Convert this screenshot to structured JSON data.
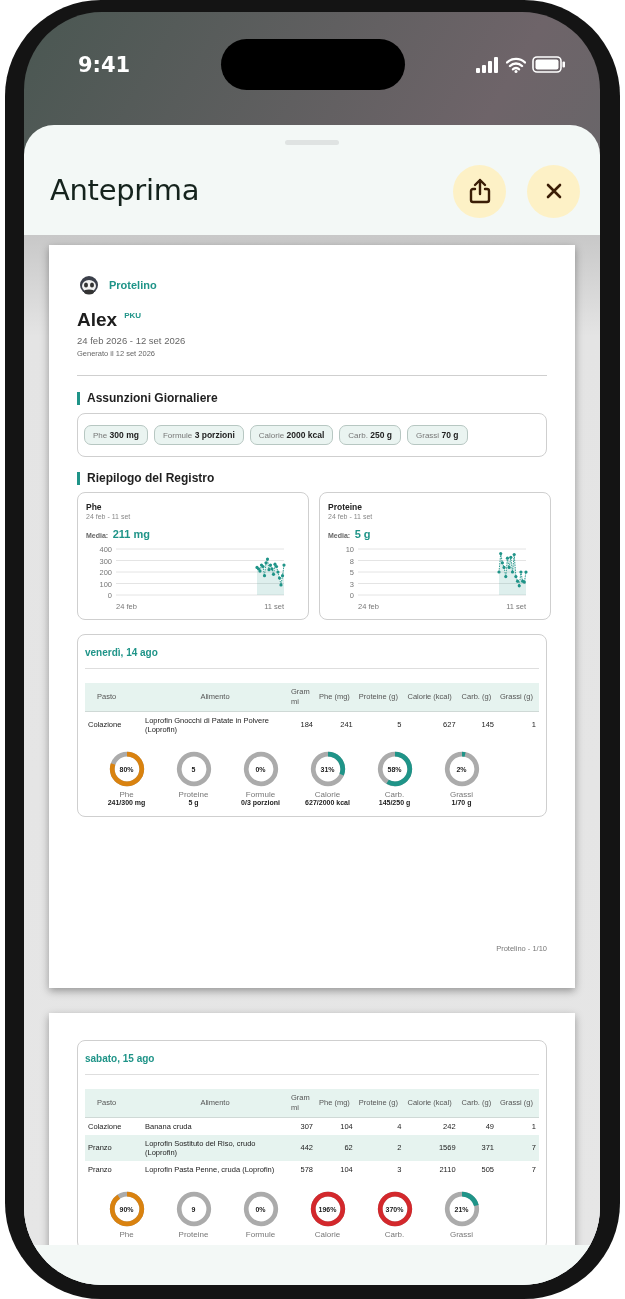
{
  "status_bar": {
    "time": "9:41"
  },
  "sheet": {
    "title": "Anteprima"
  },
  "pages": [
    {
      "header": {
        "brand": "Protelino",
        "name": "Alex",
        "tag": "PKU",
        "range": "24 feb 2026 - 12 set 2026",
        "generated": "Generato il 12 set 2026",
        "intake_heading": "Assunzioni Giornaliere",
        "chips": [
          {
            "label": "Phe",
            "value": "300 mg"
          },
          {
            "label": "Formule",
            "value": "3 porzioni"
          },
          {
            "label": "Calorie",
            "value": "2000 kcal"
          },
          {
            "label": "Carb.",
            "value": "250 g"
          },
          {
            "label": "Grassi",
            "value": "70 g"
          }
        ],
        "summary_heading": "Riepilogo del Registro",
        "summary_cards": [
          {
            "title": "Phe",
            "range": "24 feb - 11 set",
            "avg_label": "Media:",
            "avg_value": "211 mg",
            "y_ticks": [
              "400",
              "300",
              "200",
              "100",
              "0"
            ],
            "x_ticks": [
              "24 feb",
              "11 set"
            ]
          },
          {
            "title": "Proteine",
            "range": "24 feb - 11 set",
            "avg_label": "Media:",
            "avg_value": "5 g",
            "y_ticks": [
              "10",
              "8",
              "5",
              "3",
              "0"
            ],
            "x_ticks": [
              "24 feb",
              "11 set"
            ]
          }
        ]
      },
      "days": [
        {
          "date": "venerdì, 14 ago",
          "columns": [
            "Pasto",
            "Alimento",
            "Grammi",
            "Phe (mg)",
            "Proteine (g)",
            "Calorie (kcal)",
            "Carb. (g)",
            "Grassi (g)"
          ],
          "rows": [
            [
              "Colazione",
              "Loprofin Gnocchi di Patate in Polvere (Loprofin)",
              "184",
              "241",
              "5",
              "627",
              "145",
              "1"
            ]
          ],
          "gauges": [
            {
              "center": "80%",
              "label": "Phe",
              "value": "241/300 mg",
              "level": 0.8,
              "color": "#d9820f"
            },
            {
              "center": "5",
              "label": "Proteine",
              "value": "5 g"
            },
            {
              "center": "0%",
              "label": "Formule",
              "value": "0/3 porzioni"
            },
            {
              "center": "31%",
              "label": "Calorie",
              "value": "627/2000 kcal",
              "level": 0.31,
              "color": "#1f9488"
            },
            {
              "center": "58%",
              "label": "Carb.",
              "value": "145/250 g",
              "level": 0.58,
              "color": "#1f9488"
            },
            {
              "center": "2%",
              "label": "Grassi",
              "value": "1/70 g",
              "level": 0.02,
              "color": "#1f9488"
            }
          ]
        }
      ],
      "footer": "Protelino - 1/10"
    },
    {
      "days": [
        {
          "date": "sabato, 15 ago",
          "columns": [
            "Pasto",
            "Alimento",
            "Grammi",
            "Phe (mg)",
            "Proteine (g)",
            "Calorie (kcal)",
            "Carb. (g)",
            "Grassi (g)"
          ],
          "rows": [
            [
              "Colazione",
              "Banana cruda",
              "307",
              "104",
              "4",
              "242",
              "49",
              "1"
            ],
            [
              "Pranzo",
              "Loprofin Sostituto del Riso, crudo (Loprofin)",
              "442",
              "62",
              "2",
              "1569",
              "371",
              "7"
            ],
            [
              "Pranzo",
              "Loprofin Pasta Penne, cruda (Loprofin)",
              "578",
              "104",
              "3",
              "2110",
              "505",
              "7"
            ]
          ],
          "gauges": [
            {
              "center": "90%",
              "label": "Phe",
              "level": 0.9,
              "color": "#d9820f"
            },
            {
              "center": "9",
              "label": "Proteine"
            },
            {
              "center": "0%",
              "label": "Formule"
            },
            {
              "center": "196%",
              "label": "Calorie",
              "level": 1,
              "color": "#d3282c"
            },
            {
              "center": "370%",
              "label": "Carb.",
              "level": 1,
              "color": "#d3282c"
            },
            {
              "center": "21%",
              "label": "Grassi",
              "level": 0.21,
              "color": "#1f9488"
            }
          ]
        }
      ]
    }
  ]
}
